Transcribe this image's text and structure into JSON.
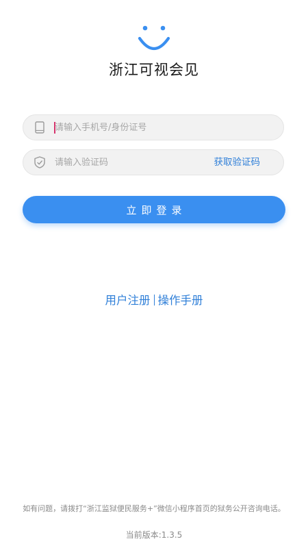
{
  "app": {
    "title": "浙江可视会见",
    "accent_color": "#3a8ff0",
    "link_color": "#2f7fd8"
  },
  "logo": {
    "icon": "smiley-face-icon"
  },
  "login_form": {
    "phone_field": {
      "icon": "phone-icon",
      "placeholder": "请输入手机号/身份证号",
      "value": ""
    },
    "code_field": {
      "icon": "shield-icon",
      "placeholder": "请输入验证码",
      "value": "",
      "get_code_label": "获取验证码"
    },
    "login_label": "立即登录"
  },
  "links": {
    "register_label": "用户注册",
    "manual_label": "操作手册"
  },
  "footer": {
    "help_text": "如有问题，请拨打“浙江监狱便民服务+”微信小程序首页的狱务公开咨询电话。",
    "version_text": "当前版本:1.3.5"
  }
}
